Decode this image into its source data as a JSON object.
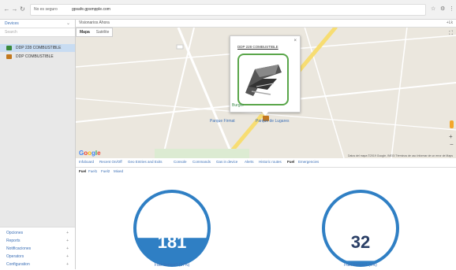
{
  "browser": {
    "secure_label": "No es seguro",
    "url": "gpsafe.gpsmpple.com"
  },
  "sidebar": {
    "header": "Devices",
    "search_placeholder": "Search",
    "devices": [
      {
        "label": "DDP 228 COMBUSTIBLE",
        "color": "#3a8a3a",
        "selected": true
      },
      {
        "label": "DDP COMBUSTIBLE",
        "color": "#c2781e",
        "selected": false
      }
    ],
    "menu": [
      {
        "label": "Opciones"
      },
      {
        "label": "Reports"
      },
      {
        "label": "Notificaciones"
      },
      {
        "label": "Operators"
      },
      {
        "label": "Configuration"
      }
    ]
  },
  "map": {
    "header_left": "Visionarios Ahora",
    "header_right": "+Lk",
    "maptype": [
      "Mapa",
      "Satélite"
    ],
    "popup_title": "DDP 228 COMBUSTIBLE",
    "places": [
      "Burger",
      "Parque Firmat",
      "Parque de Lugares"
    ],
    "google": "Google",
    "footer": "Datos del mapa ©2019 Google, INEGI   Términos de uso   Informar de un error de Maps"
  },
  "tabs": [
    "Infoboard",
    "Recent On/Off",
    "Geo Entries and Exits",
    "Console",
    "Commands",
    "Gas in device",
    "Alerts",
    "Historic routes",
    "Fuel",
    "Emergencies"
  ],
  "subtabs": [
    "Fuel",
    "Fuel1",
    "Fuel2",
    "Mixed"
  ],
  "gauges": [
    {
      "value": "181",
      "caption": "Fuel Sensor1 (37%)",
      "fraction": 0.37
    },
    {
      "value": "32",
      "caption": "Fuel Sensor1 (6%)",
      "fraction": 0.06
    }
  ],
  "colors": {
    "accent": "#3b6fb6",
    "gauge_fill": "#2f7fc4",
    "device_selected_bg": "#c8dcf2"
  }
}
